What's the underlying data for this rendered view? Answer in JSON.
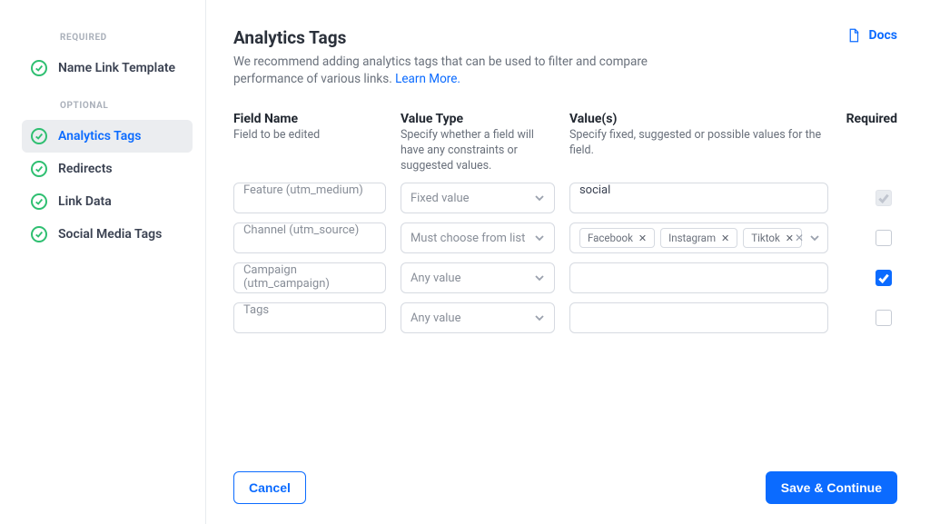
{
  "sidebar": {
    "group_required": "REQUIRED",
    "group_optional": "OPTIONAL",
    "items": [
      {
        "label": "Name Link Template",
        "active": false
      },
      {
        "label": "Analytics Tags",
        "active": true
      },
      {
        "label": "Redirects",
        "active": false
      },
      {
        "label": "Link Data",
        "active": false
      },
      {
        "label": "Social Media Tags",
        "active": false
      }
    ]
  },
  "header": {
    "title": "Analytics Tags",
    "subtitle_pre": "We recommend adding analytics tags that can be used to filter and compare performance of various links. ",
    "learn_more": "Learn More.",
    "docs_label": "Docs"
  },
  "columns": {
    "field_name": "Field Name",
    "field_name_sub": "Field to be edited",
    "value_type": "Value Type",
    "value_type_sub": "Specify whether a field will have any constraints or suggested values.",
    "values": "Value(s)",
    "values_sub": "Specify fixed, suggested or possible values for the field.",
    "required": "Required"
  },
  "rows": [
    {
      "field": "Feature (utm_medium)",
      "type": "Fixed value",
      "value_text": "social",
      "value_kind": "text",
      "required_state": "checked-disabled"
    },
    {
      "field": "Channel (utm_source)",
      "type": "Must choose from list",
      "value_kind": "tags",
      "tags": [
        "Facebook",
        "Instagram",
        "Tiktok"
      ],
      "required_state": "unchecked"
    },
    {
      "field": "Campaign (utm_campaign)",
      "type": "Any value",
      "value_kind": "empty",
      "required_state": "checked"
    },
    {
      "field": "Tags",
      "type": "Any value",
      "value_kind": "empty",
      "required_state": "unchecked"
    }
  ],
  "footer": {
    "cancel": "Cancel",
    "save": "Save & Continue"
  },
  "colors": {
    "accent": "#0b6bff",
    "success": "#2fbf71"
  }
}
